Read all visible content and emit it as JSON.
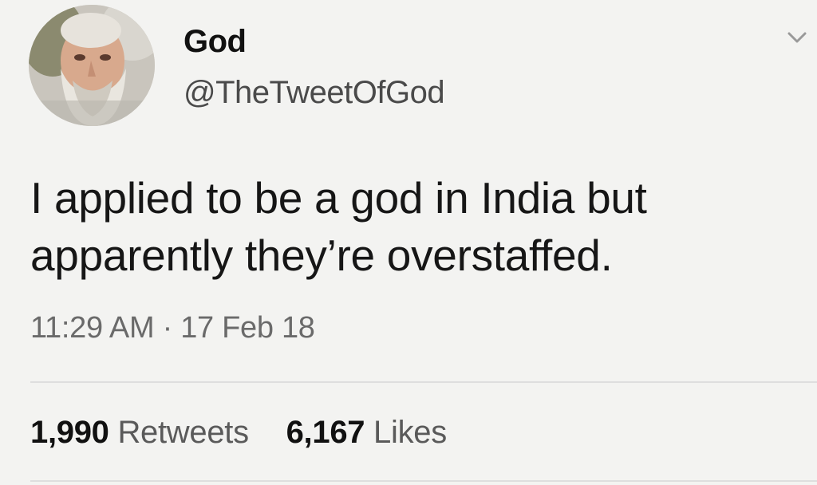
{
  "tweet": {
    "author": {
      "display_name": "God",
      "handle": "@TheTweetOfGod",
      "avatar_icon": "bearded-man-avatar"
    },
    "menu_icon": "chevron-down-icon",
    "text_lines": [
      "I applied to be a god in India but",
      "apparently they’re overstaffed."
    ],
    "timestamp": "11:29 AM · 17 Feb 18",
    "stats": {
      "retweets_count": "1,990",
      "retweets_label": "Retweets",
      "likes_count": "6,167",
      "likes_label": "Likes"
    }
  },
  "colors": {
    "background": "#f3f3f1",
    "text": "#161616",
    "secondary_text": "#6a6a6a"
  }
}
